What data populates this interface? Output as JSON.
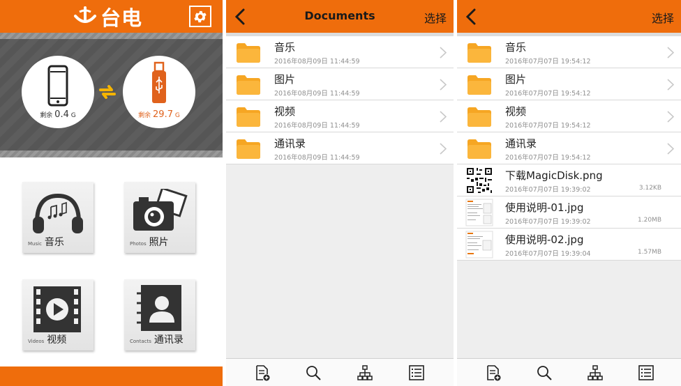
{
  "colors": {
    "accent": "#ef6d0c",
    "usb_text": "#e0621c"
  },
  "home": {
    "logo_text": "台电",
    "phone": {
      "prefix": "剩余",
      "value": "0.4",
      "unit": "G"
    },
    "usb": {
      "prefix": "剩余",
      "value": "29.7",
      "unit": "G"
    },
    "tiles": [
      {
        "en": "Music",
        "zh": "音乐",
        "icon": "headphones-icon"
      },
      {
        "en": "Photos",
        "zh": "照片",
        "icon": "camera-icon"
      },
      {
        "en": "Videos",
        "zh": "视频",
        "icon": "film-icon"
      },
      {
        "en": "Contacts",
        "zh": "通讯录",
        "icon": "contact-book-icon"
      }
    ]
  },
  "documents": {
    "title": "Documents",
    "select_label": "选择",
    "rows": [
      {
        "name": "音乐",
        "date": "2016年08月09日 11:44:59"
      },
      {
        "name": "图片",
        "date": "2016年08月09日 11:44:59"
      },
      {
        "name": "视频",
        "date": "2016年08月09日 11:44:59"
      },
      {
        "name": "通讯录",
        "date": "2016年08月09日 11:44:59"
      }
    ]
  },
  "drive": {
    "select_label": "选择",
    "folders": [
      {
        "name": "音乐",
        "date": "2016年07月07日 19:54:12"
      },
      {
        "name": "图片",
        "date": "2016年07月07日 19:54:12"
      },
      {
        "name": "视频",
        "date": "2016年07月07日 19:54:12"
      },
      {
        "name": "通讯录",
        "date": "2016年07月07日 19:54:12"
      }
    ],
    "files": [
      {
        "name": "下载MagicDisk.png",
        "date": "2016年07月07日 19:39:02",
        "size": "3.12KB",
        "thumb": "qr-code"
      },
      {
        "name": "使用说明-01.jpg",
        "date": "2016年07月07日 19:39:02",
        "size": "1.20MB",
        "thumb": "document"
      },
      {
        "name": "使用说明-02.jpg",
        "date": "2016年07月07日 19:39:04",
        "size": "1.57MB",
        "thumb": "document"
      }
    ]
  },
  "toolbar_icons": [
    "new-file-icon",
    "search-icon",
    "hierarchy-icon",
    "list-icon"
  ]
}
